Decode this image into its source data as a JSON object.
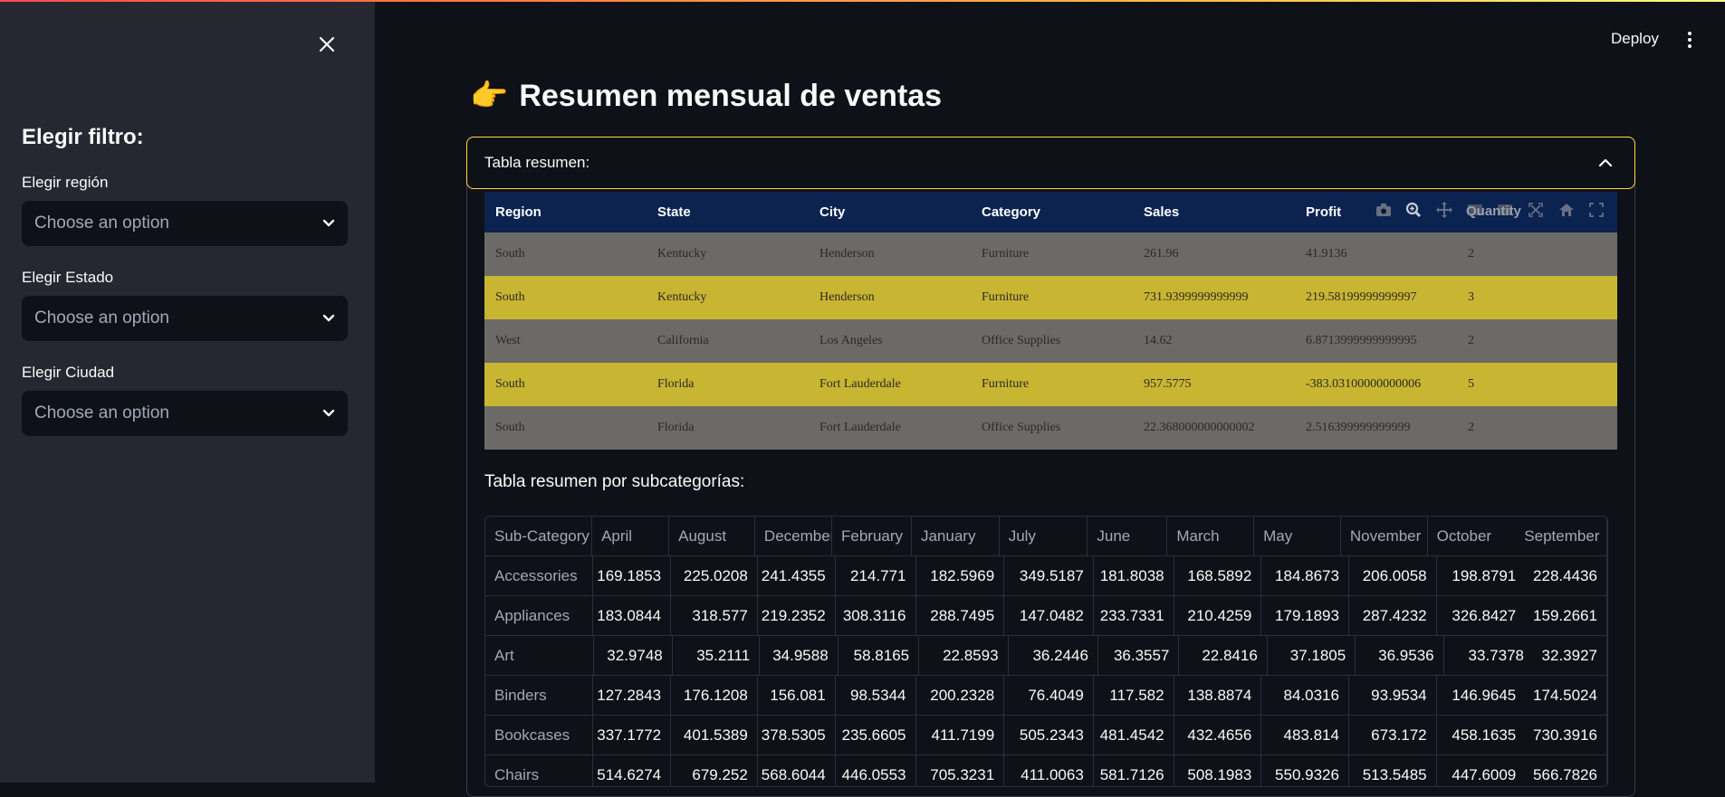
{
  "sidebar": {
    "title": "Elegir filtro:",
    "filters": [
      {
        "label": "Elegir región",
        "placeholder": "Choose an option"
      },
      {
        "label": "Elegir Estado",
        "placeholder": "Choose an option"
      },
      {
        "label": "Elegir Ciudad",
        "placeholder": "Choose an option"
      }
    ]
  },
  "header": {
    "deploy_label": "Deploy"
  },
  "main": {
    "title_emoji": "👉",
    "title": "Resumen mensual de ventas",
    "expander_label": "Tabla resumen:",
    "subtitle": "Tabla resumen por subcategorías:"
  },
  "plot_table": {
    "columns": [
      "Region",
      "State",
      "City",
      "Category",
      "Sales",
      "Profit",
      "Quantity"
    ],
    "rows": [
      [
        "South",
        "Kentucky",
        "Henderson",
        "Furniture",
        "261.96",
        "41.9136",
        "2"
      ],
      [
        "South",
        "Kentucky",
        "Henderson",
        "Furniture",
        "731.9399999999999",
        "219.58199999999997",
        "3"
      ],
      [
        "West",
        "California",
        "Los Angeles",
        "Office Supplies",
        "14.62",
        "6.8713999999999995",
        "2"
      ],
      [
        "South",
        "Florida",
        "Fort Lauderdale",
        "Furniture",
        "957.5775",
        "-383.03100000000006",
        "5"
      ],
      [
        "South",
        "Florida",
        "Fort Lauderdale",
        "Office Supplies",
        "22.368000000000002",
        "2.516399999999999",
        "2"
      ]
    ],
    "colors": {
      "header": "#0c2350",
      "odd": "#6b6a66",
      "even": "#c8b532"
    }
  },
  "summary_table": {
    "columns": [
      "Sub-Category",
      "April",
      "August",
      "December",
      "February",
      "January",
      "July",
      "June",
      "March",
      "May",
      "November",
      "October",
      "September"
    ],
    "rows": [
      [
        "Accessories",
        "169.1853",
        "225.0208",
        "241.4355",
        "214.771",
        "182.5969",
        "349.5187",
        "181.8038",
        "168.5892",
        "184.8673",
        "206.0058",
        "198.8791",
        "228.4436"
      ],
      [
        "Appliances",
        "183.0844",
        "318.577",
        "219.2352",
        "308.3116",
        "288.7495",
        "147.0482",
        "233.7331",
        "210.4259",
        "179.1893",
        "287.4232",
        "326.8427",
        "159.2661"
      ],
      [
        "Art",
        "32.9748",
        "35.2111",
        "34.9588",
        "58.8165",
        "22.8593",
        "36.2446",
        "36.3557",
        "22.8416",
        "37.1805",
        "36.9536",
        "33.7378",
        "32.3927"
      ],
      [
        "Binders",
        "127.2843",
        "176.1208",
        "156.081",
        "98.5344",
        "200.2328",
        "76.4049",
        "117.582",
        "138.8874",
        "84.0316",
        "93.9534",
        "146.9645",
        "174.5024"
      ],
      [
        "Bookcases",
        "337.1772",
        "401.5389",
        "378.5305",
        "235.6605",
        "411.7199",
        "505.2343",
        "481.4542",
        "432.4656",
        "483.814",
        "673.172",
        "458.1635",
        "730.3916"
      ],
      [
        "Chairs",
        "514.6274",
        "679.252",
        "568.6044",
        "446.0553",
        "705.3231",
        "411.0063",
        "581.7126",
        "508.1983",
        "550.9326",
        "513.5485",
        "447.6009",
        "566.7826"
      ]
    ]
  }
}
